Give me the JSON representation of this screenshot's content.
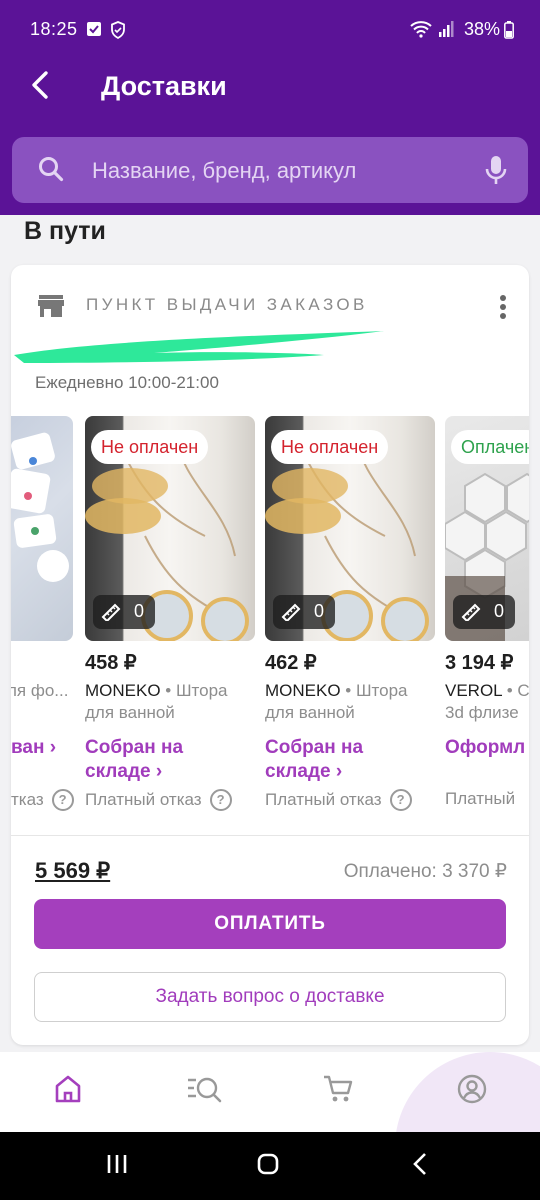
{
  "status_bar": {
    "time": "18:25",
    "battery": "38%"
  },
  "header": {
    "title": "Доставки"
  },
  "search": {
    "placeholder": "Название, бренд, артикул"
  },
  "section": {
    "title": "В пути"
  },
  "card": {
    "pickup_label": "ПУНКТ ВЫДАЧИ ЗАКАЗОВ",
    "hours": "Ежедневно 10:00-21:00",
    "total": "5 569 ₽",
    "paid": "Оплачено: 3 370 ₽",
    "pay_button": "ОПЛАТИТЬ",
    "ask_button": "Задать вопрос о доставке"
  },
  "products": [
    {
      "badge": "",
      "size_count": "",
      "price": "",
      "brand": "",
      "desc1": "ля фо...",
      "desc2": "",
      "status": "ван ›",
      "status2": "",
      "refund": "тказ"
    },
    {
      "badge": "Не оплачен",
      "badge_type": "unpaid",
      "size_count": "0",
      "price": "458 ₽",
      "brand": "MONEKO",
      "desc1": "• Штора",
      "desc2": "для ванной",
      "status": "Собран на",
      "status2": "складе ›",
      "refund": "Платный отказ"
    },
    {
      "badge": "Не оплачен",
      "badge_type": "unpaid",
      "size_count": "0",
      "price": "462 ₽",
      "brand": "MONEKO",
      "desc1": "• Штора",
      "desc2": "для ванной",
      "status": "Собран на",
      "status2": "складе ›",
      "refund": "Платный отказ"
    },
    {
      "badge": "Оплачен",
      "badge_type": "paid",
      "size_count": "0",
      "price": "3 194 ₽",
      "brand": "VEROL",
      "desc1": "• С",
      "desc2": "3d флизе",
      "status": "Оформл",
      "status2": "",
      "refund": "Платный"
    }
  ],
  "colors": {
    "brand": "#5b1397",
    "accent": "#a43fbd",
    "unpaid": "#d4232e",
    "paid": "#2ea24d"
  },
  "icons": {
    "back": "back-arrow-icon",
    "search": "search-icon",
    "mic": "mic-icon",
    "store": "store-icon",
    "more": "more-vertical-icon",
    "home": "home-icon",
    "catalog": "catalog-search-icon",
    "cart": "cart-icon",
    "profile": "profile-icon"
  }
}
